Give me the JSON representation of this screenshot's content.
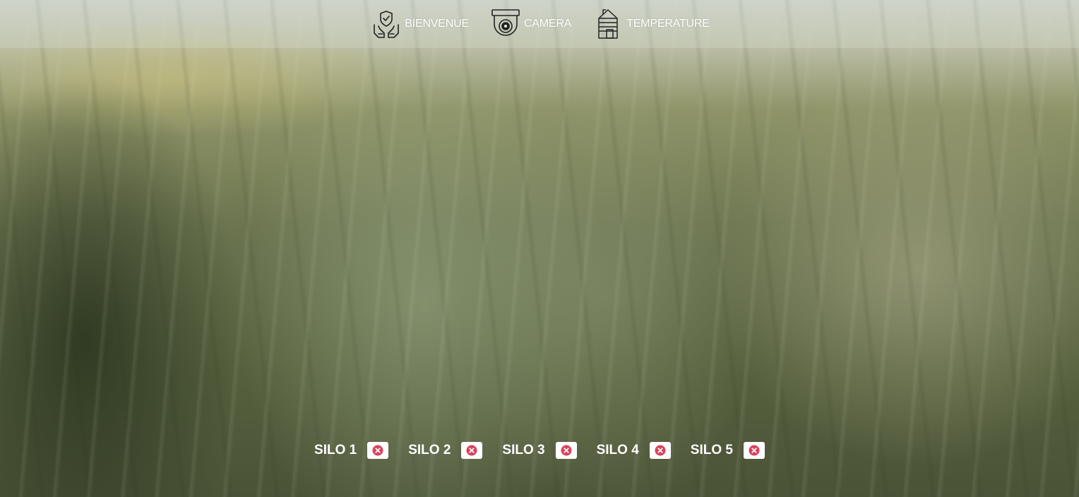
{
  "nav": {
    "items": [
      {
        "label": "BIENVENUE",
        "icon": "hands-shield-icon"
      },
      {
        "label": "CAMERA",
        "icon": "security-camera-icon"
      },
      {
        "label": "TEMPERATURE",
        "icon": "silo-icon"
      }
    ]
  },
  "silos": {
    "items": [
      {
        "label": "SILO 1",
        "status_icon": "error-x-icon"
      },
      {
        "label": "SILO 2",
        "status_icon": "error-x-icon"
      },
      {
        "label": "SILO 3",
        "status_icon": "error-x-icon"
      },
      {
        "label": "SILO 4",
        "status_icon": "error-x-icon"
      },
      {
        "label": "SILO 5",
        "status_icon": "error-x-icon"
      }
    ]
  },
  "colors": {
    "status_error": "#d9435a",
    "nav_text": "#ffffff"
  }
}
